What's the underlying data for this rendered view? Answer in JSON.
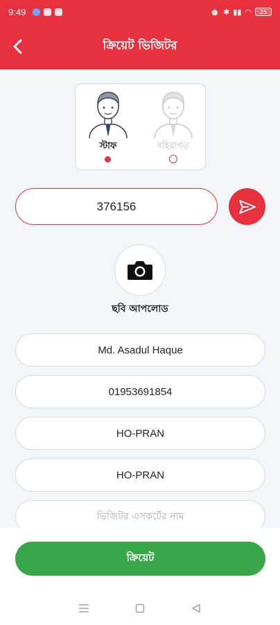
{
  "status_bar": {
    "time": "9:49",
    "battery": "25"
  },
  "app_bar": {
    "title": "ক্রিয়েট ভিজিটর",
    "back_icon": "chevron-left-icon"
  },
  "visitor_type": {
    "options": [
      {
        "label": "স্টাফ",
        "selected": true
      },
      {
        "label": "বহিরাগত",
        "selected": false
      }
    ]
  },
  "code_input": {
    "value": "376156"
  },
  "send_icon": "send-icon",
  "photo": {
    "icon": "camera-icon",
    "label": "ছবি আপলোড"
  },
  "fields": {
    "name": "Md. Asadul Haque",
    "phone": "01953691854",
    "field3": "HO-PRAN",
    "field4": "HO-PRAN",
    "escort_placeholder": "ভিজিটর এসকর্টের নাম"
  },
  "create_button": {
    "label": "ক্রিয়েট"
  },
  "colors": {
    "primary": "#e8313f",
    "success": "#3aa64a",
    "background": "#f3f6f9"
  }
}
